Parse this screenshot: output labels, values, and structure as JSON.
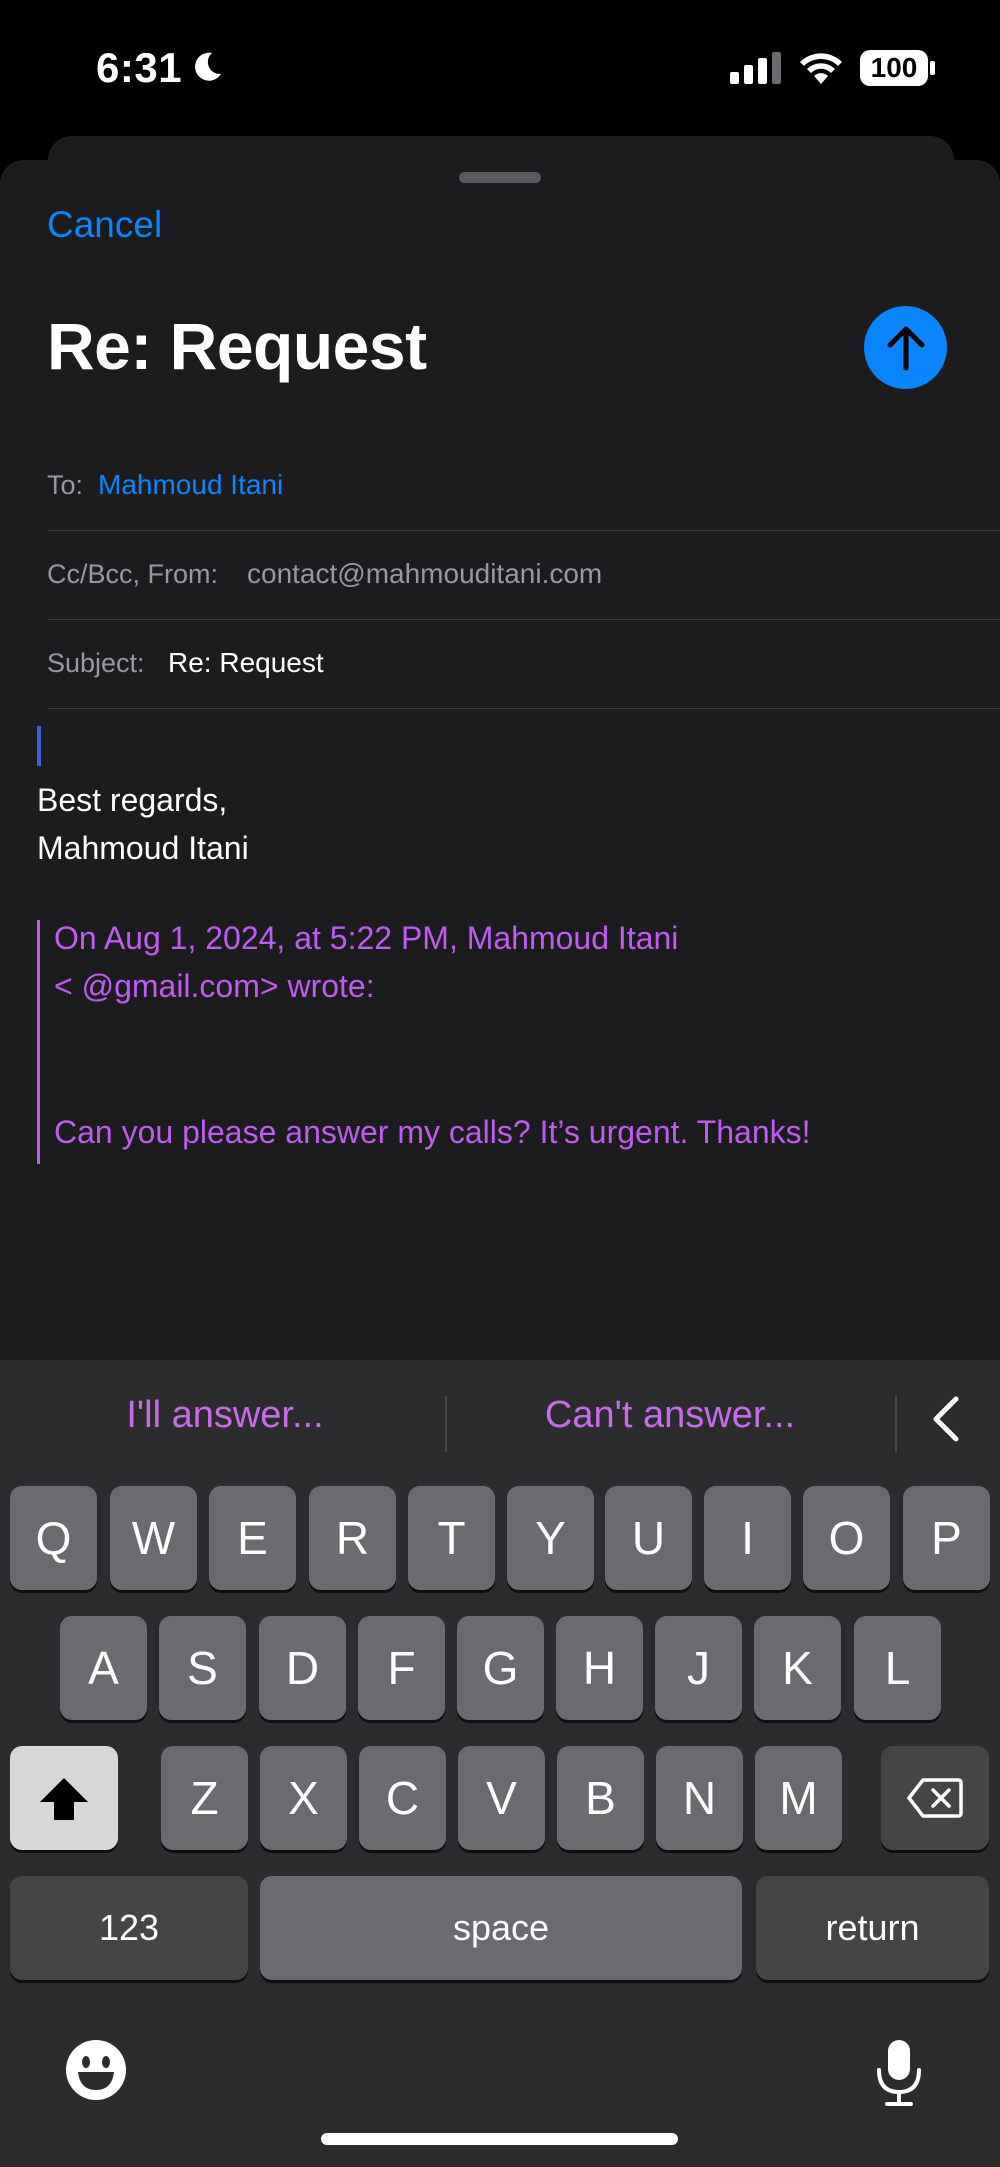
{
  "status_bar": {
    "time": "6:31",
    "battery": "100"
  },
  "compose": {
    "cancel_label": "Cancel",
    "title": "Re: Request",
    "to_label": "To:",
    "to_value": "Mahmoud Itani",
    "ccbcc_label": "Cc/Bcc, From:",
    "from_value": "contact@mahmouditani.com",
    "subject_label": "Subject:",
    "subject_value": "Re: Request",
    "body": {
      "line1": "Best regards,",
      "line2": "Mahmoud Itani"
    },
    "quote": {
      "header1": "On Aug 1, 2024, at 5:22 PM, Mahmoud Itani",
      "header2": "<                @gmail.com> wrote:",
      "message": "Can you please answer my calls? It’s urgent. Thanks!"
    }
  },
  "keyboard": {
    "suggestions": [
      "I'll answer...",
      "Can't answer..."
    ],
    "row1": [
      "Q",
      "W",
      "E",
      "R",
      "T",
      "Y",
      "U",
      "I",
      "O",
      "P"
    ],
    "row2": [
      "A",
      "S",
      "D",
      "F",
      "G",
      "H",
      "J",
      "K",
      "L"
    ],
    "row3": [
      "Z",
      "X",
      "C",
      "V",
      "B",
      "N",
      "M"
    ],
    "numbers_label": "123",
    "space_label": "space",
    "return_label": "return"
  },
  "colors": {
    "accent": "#0a84ff",
    "quote": "#bf5af2",
    "suggestion": "#c86be8"
  }
}
